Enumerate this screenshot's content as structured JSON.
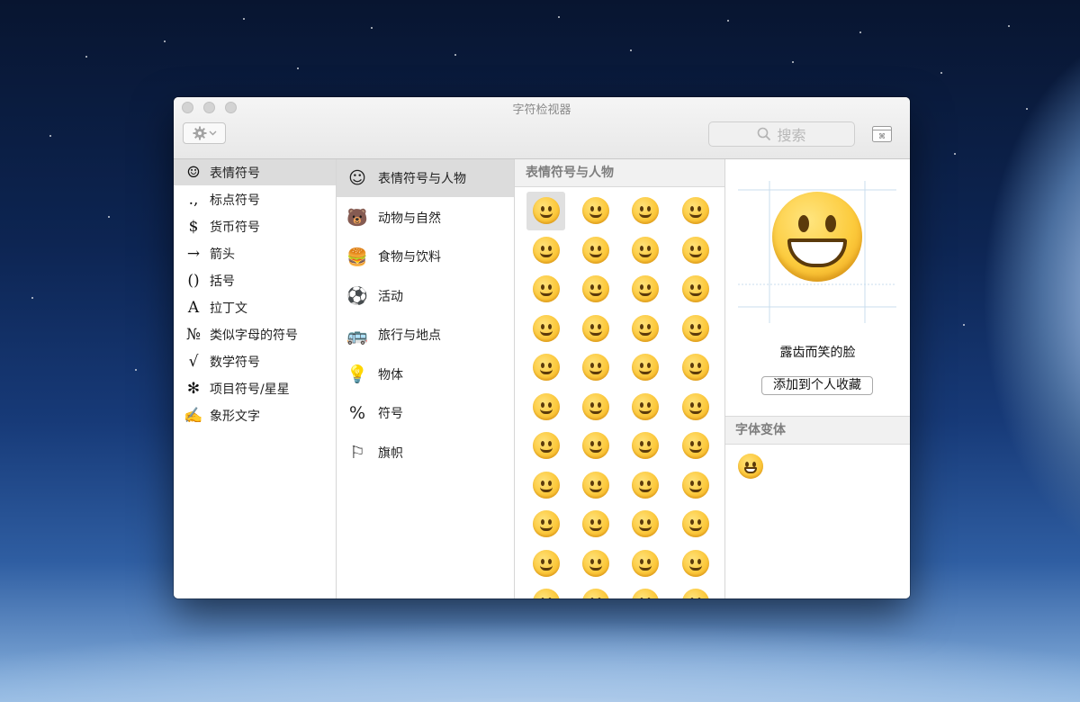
{
  "window": {
    "title": "字符检视器",
    "search_placeholder": "搜索"
  },
  "categories": [
    {
      "icon": "☺",
      "icon_name": "smiley-icon",
      "label": "表情符号",
      "selected": true
    },
    {
      "icon": ".,",
      "icon_name": "punctuation-icon",
      "label": "标点符号"
    },
    {
      "icon": "$",
      "icon_name": "dollar-icon",
      "label": "货币符号"
    },
    {
      "icon": "→",
      "icon_name": "arrow-icon",
      "label": "箭头"
    },
    {
      "icon": "()",
      "icon_name": "parentheses-icon",
      "label": "括号"
    },
    {
      "icon": "A",
      "icon_name": "latin-icon",
      "label": "拉丁文"
    },
    {
      "icon": "№",
      "icon_name": "numero-icon",
      "label": "类似字母的符号"
    },
    {
      "icon": "√",
      "icon_name": "sqrt-icon",
      "label": "数学符号"
    },
    {
      "icon": "✻",
      "icon_name": "asterisk-icon",
      "label": "项目符号/星星"
    },
    {
      "icon": "✍",
      "icon_name": "pictograph-icon",
      "label": "象形文字"
    }
  ],
  "subcategories": [
    {
      "icon": "☺",
      "icon_name": "smiley-icon",
      "label": "表情符号与人物",
      "selected": true
    },
    {
      "icon": "🐻",
      "icon_name": "bear-icon",
      "label": "动物与自然"
    },
    {
      "icon": "🍔",
      "icon_name": "food-icon",
      "label": "食物与饮料"
    },
    {
      "icon": "⚽",
      "icon_name": "soccer-icon",
      "label": "活动"
    },
    {
      "icon": "🚌",
      "icon_name": "bus-icon",
      "label": "旅行与地点"
    },
    {
      "icon": "💡",
      "icon_name": "lightbulb-icon",
      "label": "物体"
    },
    {
      "icon": "%",
      "icon_name": "symbols-icon",
      "label": "符号"
    },
    {
      "icon": "⚐",
      "icon_name": "flag-icon",
      "label": "旗帜"
    }
  ],
  "emoji_grid": {
    "header": "表情符号与人物",
    "rows": 11,
    "cols": 4,
    "selected_index": 0
  },
  "preview": {
    "name": "露齿而笑的脸",
    "favorite_button": "添加到个人收藏",
    "variants_header": "字体变体"
  }
}
